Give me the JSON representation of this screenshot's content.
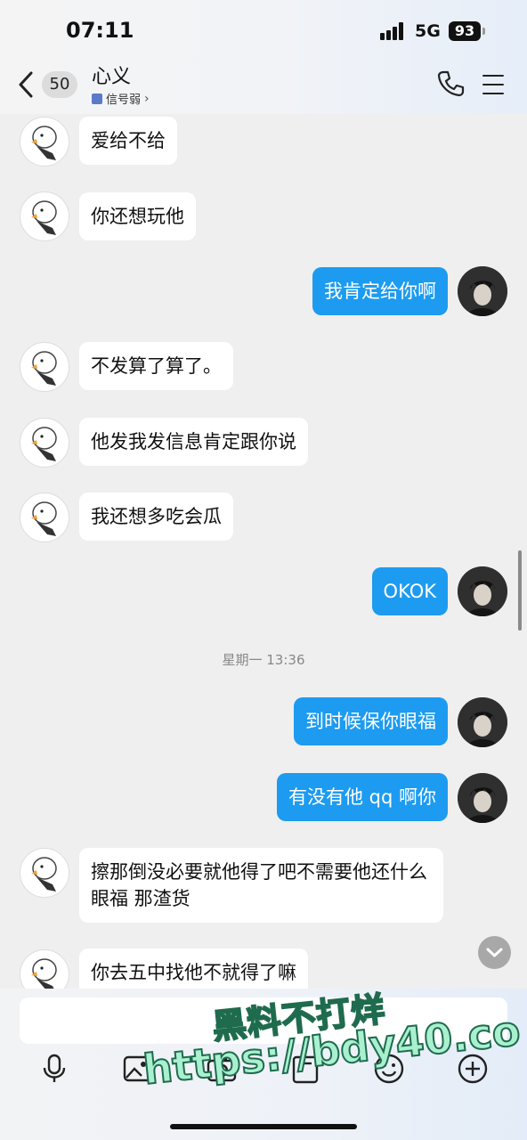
{
  "status_bar": {
    "time": "07:11",
    "network": "5G",
    "battery": "93"
  },
  "header": {
    "unread_count": "50",
    "contact_name": "心义",
    "signal_status": "信号弱"
  },
  "messages": [
    {
      "side": "in",
      "text": "爱给不给"
    },
    {
      "side": "in",
      "text": "你还想玩他"
    },
    {
      "side": "out",
      "text": "我肯定给你啊"
    },
    {
      "side": "in",
      "text": "不发算了算了。"
    },
    {
      "side": "in",
      "text": "他发我发信息肯定跟你说"
    },
    {
      "side": "in",
      "text": "我还想多吃会瓜"
    },
    {
      "side": "out",
      "text": "OKOK"
    },
    {
      "side": "out",
      "text": "到时候保你眼福"
    },
    {
      "side": "out",
      "text": "有没有他 qq 啊你"
    },
    {
      "side": "in",
      "text": "擦那倒没必要就他得了吧不需要他还什么眼福 那渣货"
    },
    {
      "side": "in",
      "text": "你去五中找他不就得了嘛"
    }
  ],
  "timestamp_divider": "星期一 13:36",
  "watermark": {
    "line1": "黑料不打烊",
    "line2": "https://bdy40.co"
  },
  "icons": {
    "back": "chevron-left-icon",
    "phone": "phone-icon",
    "menu": "menu-icon",
    "voice": "microphone-icon",
    "image": "image-icon",
    "camera": "camera-icon",
    "folder": "folder-icon",
    "emoji": "emoji-icon",
    "more": "plus-icon"
  },
  "colors": {
    "outgoing_bubble": "#1d9bf0",
    "incoming_bubble": "#ffffff",
    "chat_bg": "#efefef"
  }
}
